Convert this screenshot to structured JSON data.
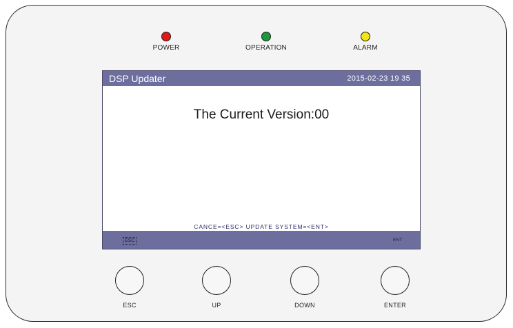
{
  "indicators": [
    {
      "label": "POWER",
      "color": "#e01818"
    },
    {
      "label": "OPERATION",
      "color": "#1a9a3a"
    },
    {
      "label": "ALARM",
      "color": "#f2e418"
    }
  ],
  "screen": {
    "title": "DSP Updater",
    "datetime": "2015-02-23   19 35",
    "message": "The Current Version:00",
    "hint": "CANCE=<ESC>  UPDATE SYSTEM=<ENT>",
    "esc_key": "ESC",
    "ent_key": "ENT"
  },
  "buttons": [
    {
      "label": "ESC"
    },
    {
      "label": "UP"
    },
    {
      "label": "DOWN"
    },
    {
      "label": "ENTER"
    }
  ]
}
